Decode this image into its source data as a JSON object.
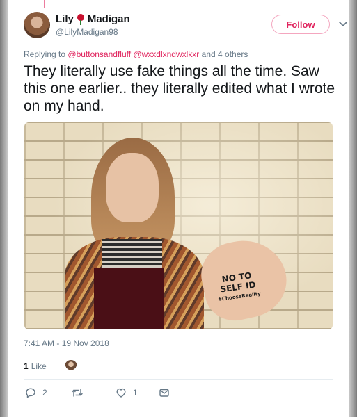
{
  "tweet": {
    "author": {
      "display_name_first": "Lily",
      "display_name_last": "Madigan",
      "handle": "@LilyMadigan98"
    },
    "follow_label": "Follow",
    "replying": {
      "prefix": "Replying to",
      "mention_1": "@buttonsandfluff",
      "mention_2": "@wxxdlxndwxlkxr",
      "suffix": "and 4 others"
    },
    "text": "They literally use fake things all the time. Saw this one earlier.. they literally edited what I wrote on my hand.",
    "photo": {
      "hand_line_1": "NO TO",
      "hand_line_2": "SELF ID",
      "hand_line_3": "#ChooseReality"
    },
    "timestamp": "7:41 AM - 19 Nov 2018",
    "likes": {
      "count": "1",
      "label": "Like"
    },
    "actions": {
      "reply_count": "2",
      "like_count": "1"
    },
    "colors": {
      "accent": "#e0245e",
      "secondary_text": "#657786"
    }
  }
}
